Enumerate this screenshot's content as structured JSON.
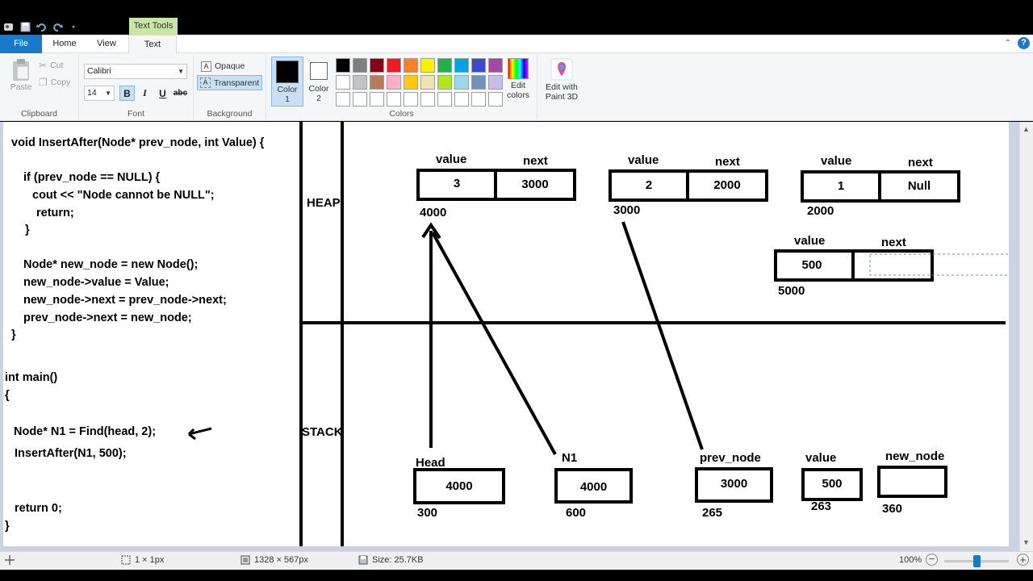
{
  "ribbon_context": "Text Tools",
  "tabs": {
    "file": "File",
    "home": "Home",
    "view": "View",
    "text": "Text"
  },
  "clipboard": {
    "paste": "Paste",
    "cut": "Cut",
    "copy": "Copy",
    "label": "Clipboard"
  },
  "font": {
    "family": "Calibri",
    "size": "14",
    "bold": "B",
    "italic": "I",
    "underline": "U",
    "strike": "abc",
    "label": "Font"
  },
  "background": {
    "opaque": "Opaque",
    "transparent": "Transparent",
    "label": "Background"
  },
  "colors": {
    "color1_label": "Color",
    "color1_num": "1",
    "color2_label": "Color",
    "color2_num": "2",
    "edit": "Edit",
    "edit2": "colors",
    "label": "Colors",
    "color1_value": "#000000",
    "color2_value": "#ffffff",
    "palette": [
      "#000000",
      "#7f7f7f",
      "#880015",
      "#ed1c24",
      "#ff7f27",
      "#fff200",
      "#22b14c",
      "#00a2e8",
      "#3f48cc",
      "#a349a4",
      "#ffffff",
      "#c3c3c3",
      "#b97a57",
      "#ffaec9",
      "#ffc90e",
      "#efe4b0",
      "#b5e61d",
      "#99d9ea",
      "#7092be",
      "#c8bfe7",
      "#ffffff",
      "#ffffff",
      "#ffffff",
      "#ffffff",
      "#ffffff",
      "#ffffff",
      "#ffffff",
      "#ffffff",
      "#ffffff",
      "#ffffff"
    ]
  },
  "paint3d": {
    "line1": "Edit with",
    "line2": "Paint 3D"
  },
  "code": {
    "l1": "void InsertAfter(Node* prev_node, int Value) {",
    "l2": "if (prev_node == NULL) {",
    "l3": "cout << \"Node cannot be NULL\";",
    "l4": "return;",
    "l5": "}",
    "l6": "Node* new_node = new Node();",
    "l7": "new_node->value = Value;",
    "l8": "new_node->next = prev_node->next;",
    "l9": "prev_node->next = new_node;",
    "l10": "}",
    "l11": "int main()",
    "l12": "{",
    "l13": "Node* N1 = Find(head, 2);",
    "l14": "InsertAfter(N1, 500);",
    "l15": "return 0;",
    "l16": "}"
  },
  "diagram": {
    "heap": "HEAP",
    "stack": "STACK",
    "node1": {
      "value_hdr": "value",
      "next_hdr": "next",
      "value": "3",
      "next": "3000",
      "addr": "4000"
    },
    "node2": {
      "value_hdr": "value",
      "next_hdr": "next",
      "value": "2",
      "next": "2000",
      "addr": "3000"
    },
    "node3": {
      "value_hdr": "value",
      "next_hdr": "next",
      "value": "1",
      "next": "Null",
      "addr": "2000"
    },
    "node4": {
      "value_hdr": "value",
      "next_hdr": "next",
      "value": "500",
      "addr": "5000"
    },
    "head": {
      "label": "Head",
      "value": "4000",
      "addr": "300"
    },
    "n1": {
      "label": "N1",
      "value": "4000",
      "addr": "600"
    },
    "prev_node": {
      "label": "prev_node",
      "value": "3000",
      "addr": "265"
    },
    "value_var": {
      "label": "value",
      "value": "500",
      "addr": "263"
    },
    "new_node": {
      "label": "new_node",
      "addr": "360"
    }
  },
  "status": {
    "selection": "1 × 1px",
    "canvas_size": "1328 × 567px",
    "file_size": "Size: 25.7KB",
    "zoom": "100%",
    "zoom_fraction": 0.5
  }
}
